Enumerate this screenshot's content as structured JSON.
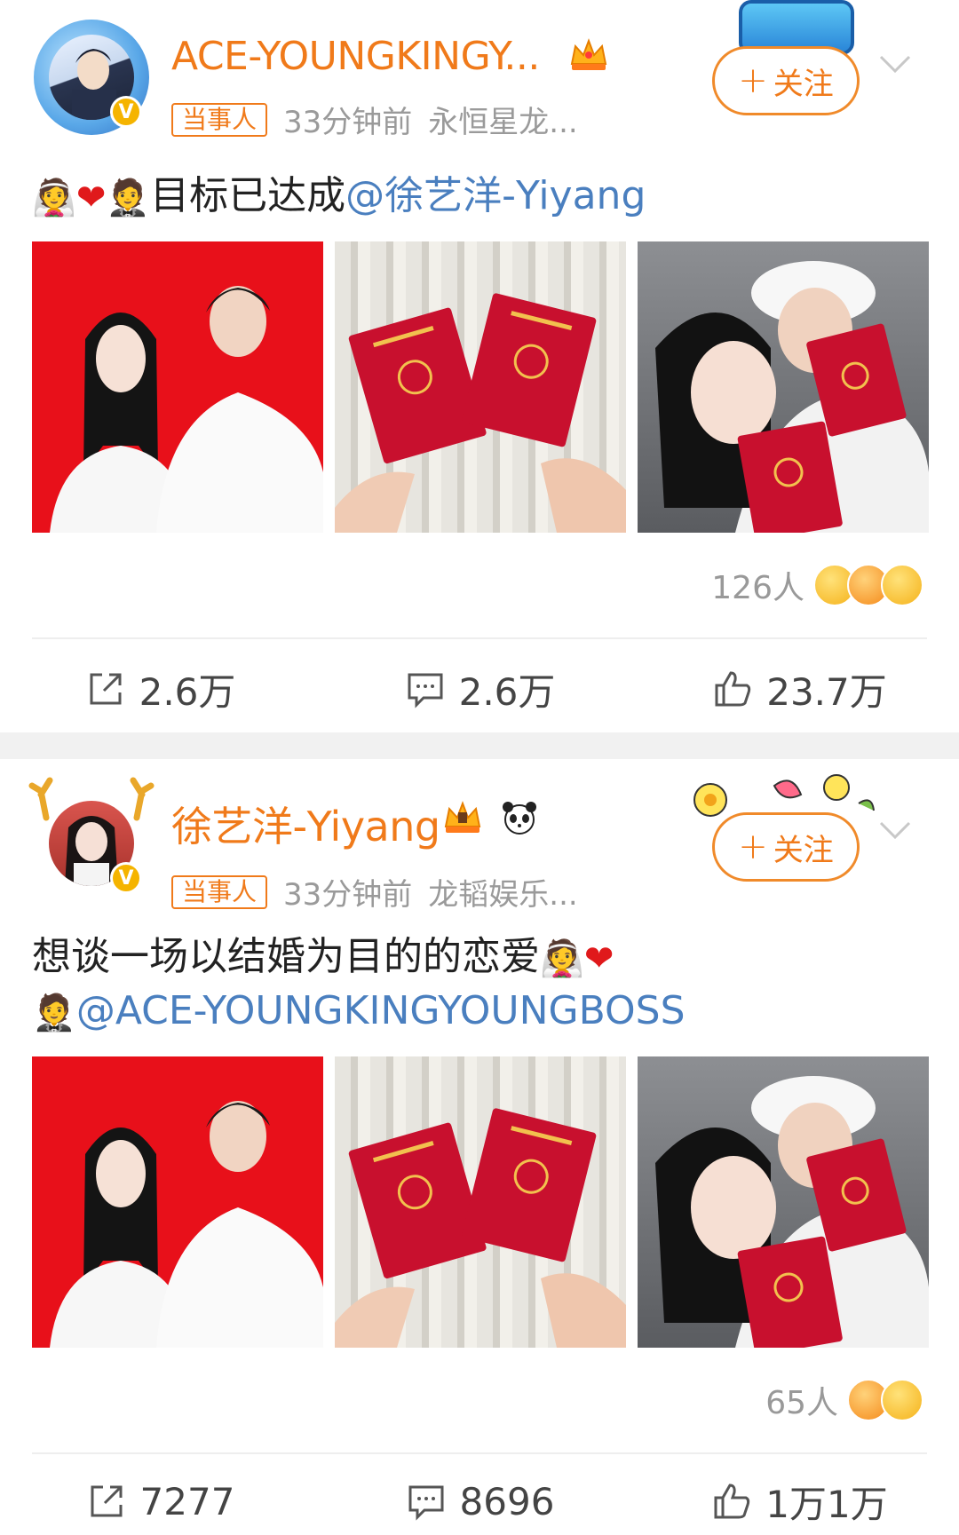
{
  "posts": [
    {
      "username": "ACE-YOUNGKINGY...",
      "tag": "当事人",
      "time": "33分钟前",
      "source": "永恒星龙...",
      "follow_label": "关注",
      "text": "目标已达成",
      "mention": "@徐艺洋-Yiyang",
      "reaction_count": "126人",
      "actions": {
        "repost": "2.6万",
        "comment": "2.6万",
        "like": "23.7万"
      }
    },
    {
      "username": "徐艺洋-Yiyang",
      "tag": "当事人",
      "time": "33分钟前",
      "source": "龙韬娱乐...",
      "follow_label": "关注",
      "text": "想谈一场以结婚为目的的恋爱",
      "mention": "@ACE-YOUNGKINGYOUNGBOSS",
      "reaction_count": "65人",
      "actions": {
        "repost": "7277",
        "comment": "8696",
        "like": "1万1万"
      }
    }
  ],
  "colors": {
    "accent": "#f07a1a",
    "mention": "#4a7fbf",
    "red_bg": "#e8101a",
    "certificate_red": "#c8102e"
  },
  "icons": [
    "repost-icon",
    "comment-icon",
    "like-icon",
    "chevron-down-icon",
    "crown-icon",
    "vip-badge-icon"
  ]
}
